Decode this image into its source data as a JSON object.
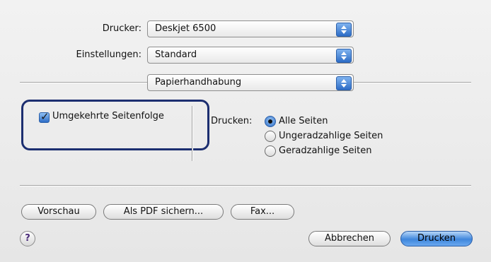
{
  "printer": {
    "label": "Drucker:",
    "value": "Deskjet 6500"
  },
  "presets": {
    "label": "Einstellungen:",
    "value": "Standard"
  },
  "panel": {
    "value": "Papierhandhabung"
  },
  "reverse_order": {
    "label": "Umgekehrte Seitenfolge",
    "checked": true
  },
  "print_pages": {
    "label": "Drucken:",
    "options": [
      {
        "label": "Alle Seiten",
        "selected": true
      },
      {
        "label": "Ungeradzahlige Seiten",
        "selected": false
      },
      {
        "label": "Geradzahlige Seiten",
        "selected": false
      }
    ]
  },
  "buttons": {
    "preview": "Vorschau",
    "save_pdf": "Als PDF sichern...",
    "fax": "Fax...",
    "cancel": "Abbrechen",
    "print": "Drucken",
    "help": "?"
  },
  "colors": {
    "accent": "#2d6cc6",
    "highlight_border": "#1c2e70"
  }
}
